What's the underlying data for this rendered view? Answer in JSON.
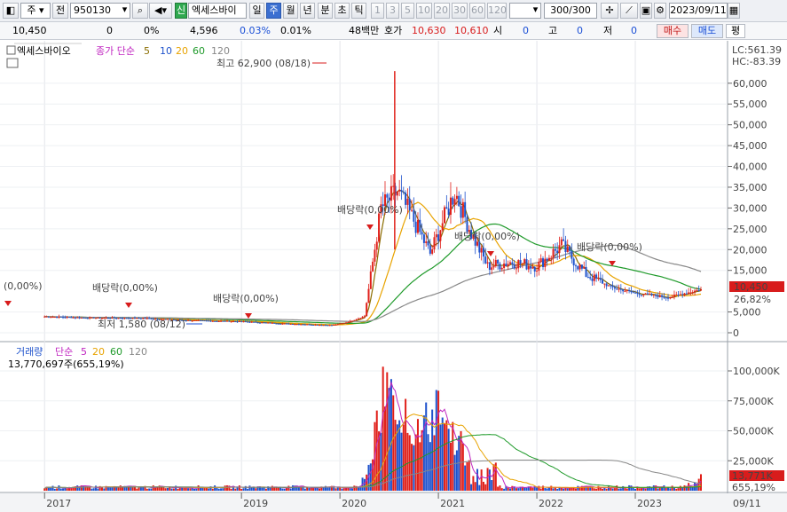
{
  "toolbar": {
    "tab_stock": "주",
    "tab_prev": "전",
    "code": "950130",
    "new_badge": "신",
    "name": "엑세스바이",
    "periods": [
      "일",
      "주",
      "월",
      "년",
      "분",
      "초",
      "틱"
    ],
    "active_period": "주",
    "numbers": [
      "1",
      "3",
      "5",
      "10",
      "20",
      "30",
      "60",
      "120"
    ],
    "count": "300",
    "count_total": "/300",
    "date": "2023/09/11"
  },
  "quote": {
    "price": "10,450",
    "change": "0",
    "change_pct": "0%",
    "volume": "4,596",
    "vol_pct": "0.03%",
    "turnover_pct": "0.01%",
    "amount": "48백만",
    "bid_label": "호가",
    "ask": "10,630",
    "bid": "10,610",
    "open_label": "시",
    "open": "0",
    "high_label": "고",
    "high": "0",
    "low_label": "저",
    "low": "0",
    "buy": "매수",
    "sell": "매도",
    "eval": "평"
  },
  "price_panel": {
    "name": "엑세스바이오",
    "ma_legend": "종가 단순",
    "ma_periods": [
      "5",
      "10",
      "20",
      "60",
      "120"
    ],
    "lc": "LC:561.39",
    "hc": "HC:-83.39",
    "high_note": "최고 62,900 (08/18)",
    "low_note": "최저 1,580 (08/12)",
    "dividend_notes": [
      "(0,00%)",
      "배당락(0,00%)",
      "배당락(0,00%)",
      "배당락(0,00%)",
      "배당락(0,00%)",
      "배당락(0,00%)"
    ],
    "current_label": "10,450",
    "pct_label": "26,82%",
    "y_ticks": [
      "60,000",
      "55,000",
      "50,000",
      "45,000",
      "40,000",
      "35,000",
      "30,000",
      "25,000",
      "20,000",
      "15,000",
      "5,000",
      "0"
    ]
  },
  "volume_panel": {
    "legend_title": "거래량",
    "legend_ma": "단순",
    "ma_periods": [
      "5",
      "20",
      "60",
      "120"
    ],
    "value_note": "13,770,697주(655,19%)",
    "current_label": "13,771K",
    "pct_label": "655,19%",
    "y_ticks": [
      "100,000K",
      "75,000K",
      "50,000K",
      "25,000K"
    ]
  },
  "x_axis": {
    "labels": [
      "2017",
      "2019",
      "2020",
      "2021",
      "2022",
      "2023"
    ],
    "end_label": "09/11"
  },
  "colors": {
    "up": "#e0201a",
    "down": "#1e52cc",
    "ma5": "#8a6d00",
    "ma20": "#e8a300",
    "ma60": "#1f9a2a",
    "ma120": "#888888",
    "vol_ma5": "#c026c0",
    "accent": "#3b6fd1"
  },
  "chart_data": [
    {
      "type": "line",
      "title": "엑세스바이오",
      "series": [
        {
          "name": "종가",
          "points": [
            [
              "2017-01",
              3900
            ],
            [
              "2017-06",
              3600
            ],
            [
              "2018-01",
              3500
            ],
            [
              "2018-06",
              3000
            ],
            [
              "2019-01",
              2700
            ],
            [
              "2019-06",
              2200
            ],
            [
              "2019-12",
              1800
            ],
            [
              "2020-02",
              2600
            ],
            [
              "2020-04",
              4000
            ],
            [
              "2020-06",
              30000
            ],
            [
              "2020-08",
              34000
            ],
            [
              "2020-10",
              27000
            ],
            [
              "2020-12",
              19000
            ],
            [
              "2021-03",
              34000
            ],
            [
              "2021-05",
              24000
            ],
            [
              "2021-07",
              16000
            ],
            [
              "2021-10",
              17000
            ],
            [
              "2022-01",
              16000
            ],
            [
              "2022-04",
              21000
            ],
            [
              "2022-07",
              14000
            ],
            [
              "2022-10",
              11000
            ],
            [
              "2023-01",
              9500
            ],
            [
              "2023-05",
              8500
            ],
            [
              "2023-09",
              10450
            ]
          ]
        }
      ],
      "ylim": [
        0,
        62900
      ],
      "annotations": [
        "최고 62,900 (08/18)",
        "최저 1,580 (08/12)"
      ]
    },
    {
      "type": "bar",
      "title": "거래량",
      "yunit": "K",
      "ylim": [
        0,
        120000
      ],
      "series": [
        {
          "name": "거래량",
          "points": [
            [
              "2020-06",
              60000
            ],
            [
              "2020-07",
              115000
            ],
            [
              "2020-08",
              95000
            ],
            [
              "2020-11",
              70000
            ],
            [
              "2021-01",
              85000
            ],
            [
              "2021-03",
              45000
            ],
            [
              "2023-09",
              13771
            ]
          ]
        }
      ]
    }
  ]
}
